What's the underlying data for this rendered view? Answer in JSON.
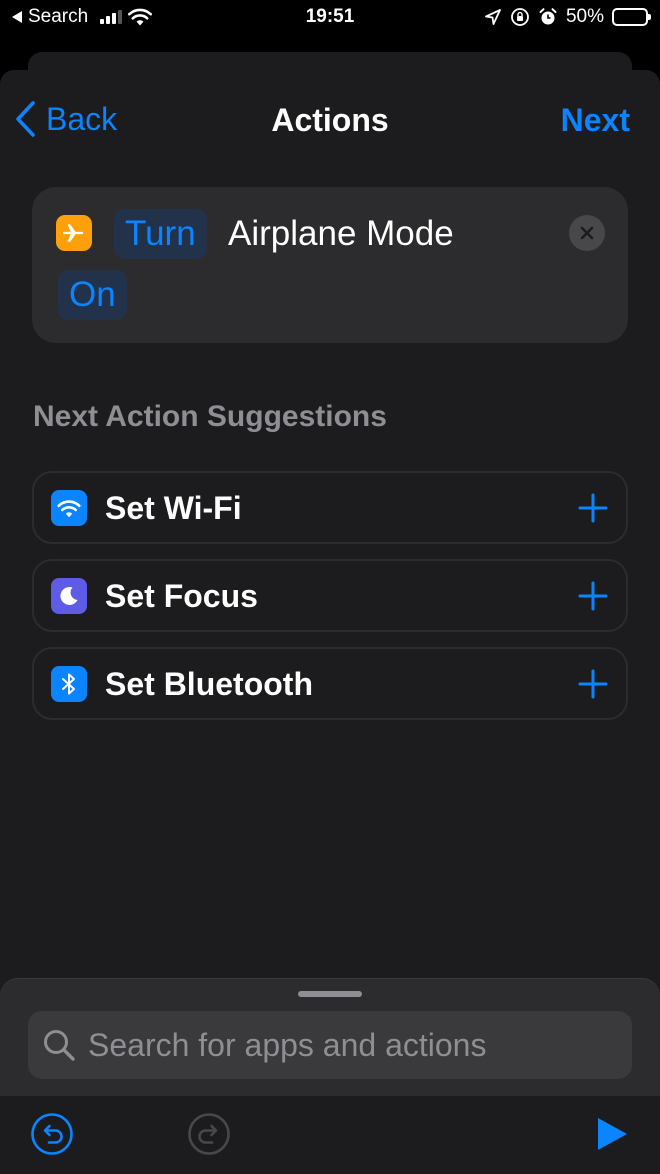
{
  "status_bar": {
    "back_app": "Search",
    "time": "19:51",
    "battery": "50%",
    "battery_level": 0.5
  },
  "nav": {
    "back_label": "Back",
    "title": "Actions",
    "next_label": "Next"
  },
  "action": {
    "icon": "airplane-icon",
    "verb": "Turn",
    "text": "Airplane Mode",
    "state": "On",
    "icon_color": "#ff9f0a"
  },
  "suggestions": {
    "header": "Next Action Suggestions",
    "items": [
      {
        "label": "Set Wi-Fi",
        "icon": "wifi-icon",
        "color": "#0a84ff"
      },
      {
        "label": "Set Focus",
        "icon": "moon-icon",
        "color": "#5e5ce6"
      },
      {
        "label": "Set Bluetooth",
        "icon": "bluetooth-icon",
        "color": "#0a84ff"
      }
    ]
  },
  "search": {
    "placeholder": "Search for apps and actions",
    "value": ""
  },
  "colors": {
    "accent": "#0a84ff",
    "background": "#1c1c1e",
    "card": "#2c2c2e"
  }
}
